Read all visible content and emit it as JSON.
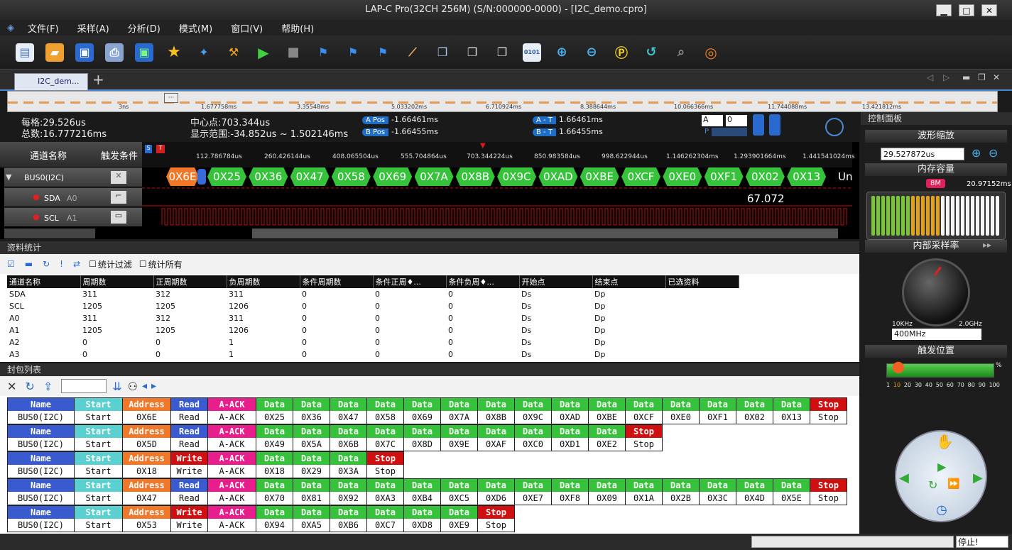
{
  "window": {
    "title": "LAP-C Pro(32CH 256M) (S/N:000000-0000) - [I2C_demo.cpro]"
  },
  "menu": [
    "文件(F)",
    "采样(A)",
    "分析(D)",
    "模式(M)",
    "窗口(V)",
    "帮助(H)"
  ],
  "toolbar": [
    "new-file-icon",
    "open-folder-icon",
    "save-icon",
    "print-icon",
    "save-as-icon",
    "star-icon",
    "run-tools-icon",
    "settings-icon",
    "play-icon",
    "stop-icon",
    "marker-add-icon",
    "marker-a-icon",
    "marker-b-icon",
    "zoom-fit-icon",
    "copy-icon",
    "paste-icon",
    "export-icon",
    "binary-icon",
    "zoom-in-icon",
    "zoom-out-icon",
    "zoom-p-icon",
    "undo-zoom-icon",
    "search-icon",
    "help-ring-icon"
  ],
  "tab": {
    "label": "I2C_dem...",
    "close": "✕",
    "add": "+"
  },
  "overview": {
    "ticks": [
      "3ns",
      "1.677758ms",
      "3.35548ms",
      "5.033202ms",
      "6.710924ms",
      "8.388644ms",
      "10.066366ms",
      "11.744088ms",
      "13.421812ms"
    ]
  },
  "info": {
    "per_div": "每格:29.526us",
    "total": "总数:16.777216ms",
    "center": "中心点:703.344us",
    "range": "显示范围:-34.852us ~ 1.502146ms",
    "a_pos_label": "A Pos",
    "a_pos": "-1.66461ms",
    "b_pos_label": "B Pos",
    "b_pos": "-1.66455ms",
    "a_t_label": "A - T",
    "a_t": "1.66461ms",
    "b_t_label": "B - T",
    "b_t": "1.66455ms",
    "sel1": "A",
    "sel2": "0",
    "p": "P"
  },
  "channels": {
    "header_name": "通道名称",
    "header_trigger": "触发条件",
    "bus": "BUS0(I2C)",
    "sda": "SDA",
    "sda_alias": "A0",
    "scl": "SCL",
    "scl_alias": "A1"
  },
  "ruler": [
    "112.786784us",
    "260.426144us",
    "408.065504us",
    "555.704864us",
    "703.344224us",
    "850.983584us",
    "998.622944us",
    "1.146262304ms",
    "1.293901664ms",
    "1.441541024ms"
  ],
  "wave": {
    "packets": [
      "0X6E",
      "0X25",
      "0X36",
      "0X47",
      "0X58",
      "0X69",
      "0X7A",
      "0X8B",
      "0X9C",
      "0XAD",
      "0XBE",
      "0XCF",
      "0XE0",
      "0XF1",
      "0X02",
      "0X13"
    ],
    "tail": "Un",
    "measure": "67.072"
  },
  "stats": {
    "title": "资料统计",
    "filter": "统计过滤",
    "all": "统计所有",
    "columns": [
      "通道名称",
      "周期数",
      "正周期数",
      "负周期数",
      "条件周期数",
      "条件正周♦...",
      "条件负周♦...",
      "开始点",
      "结束点",
      "已选资料"
    ],
    "rows": [
      [
        "SDA",
        "311",
        "312",
        "311",
        "0",
        "0",
        "0",
        "Ds",
        "Dp",
        ""
      ],
      [
        "SCL",
        "1205",
        "1205",
        "1206",
        "0",
        "0",
        "0",
        "Ds",
        "Dp",
        ""
      ],
      [
        "A0",
        "311",
        "312",
        "311",
        "0",
        "0",
        "0",
        "Ds",
        "Dp",
        ""
      ],
      [
        "A1",
        "1205",
        "1205",
        "1206",
        "0",
        "0",
        "0",
        "Ds",
        "Dp",
        ""
      ],
      [
        "A2",
        "0",
        "0",
        "1",
        "0",
        "0",
        "0",
        "Ds",
        "Dp",
        ""
      ],
      [
        "A3",
        "0",
        "0",
        "1",
        "0",
        "0",
        "0",
        "Ds",
        "Dp",
        ""
      ]
    ]
  },
  "packets": {
    "title": "封包列表",
    "rows": [
      {
        "dir": "Read",
        "data": [
          "0X25",
          "0X36",
          "0X47",
          "0X58",
          "0X69",
          "0X7A",
          "0X8B",
          "0X9C",
          "0XAD",
          "0XBE",
          "0XCF",
          "0XE0",
          "0XF1",
          "0X02",
          "0X13"
        ],
        "addr": "0X6E"
      },
      {
        "dir": "Read",
        "data": [
          "0X49",
          "0X5A",
          "0X6B",
          "0X7C",
          "0X8D",
          "0X9E",
          "0XAF",
          "0XC0",
          "0XD1",
          "0XE2"
        ],
        "addr": "0X5D"
      },
      {
        "dir": "Write",
        "data": [
          "0X18",
          "0X29",
          "0X3A"
        ],
        "addr": "0X18"
      },
      {
        "dir": "Read",
        "data": [
          "0X70",
          "0X81",
          "0X92",
          "0XA3",
          "0XB4",
          "0XC5",
          "0XD6",
          "0XE7",
          "0XF8",
          "0X09",
          "0X1A",
          "0X2B",
          "0X3C",
          "0X4D",
          "0X5E"
        ],
        "addr": "0X47"
      },
      {
        "dir": "Write",
        "data": [
          "0X94",
          "0XA5",
          "0XB6",
          "0XC7",
          "0XD8",
          "0XE9"
        ],
        "addr": "0X53"
      }
    ],
    "labels": {
      "name": "Name",
      "bus": "BUS0(I2C)",
      "start": "Start",
      "address": "Address",
      "ack": "A-ACK",
      "data": "Data",
      "stop": "Stop"
    }
  },
  "right": {
    "title": "控制面板",
    "zoom_title": "波形缩放",
    "zoom_value": "29.527872us",
    "mem_title": "内存容量",
    "mem_marker": "8M",
    "mem_value": "20.97152ms",
    "rate_title": "内部采样率",
    "rate_min": "10KHz",
    "rate_max": "2.0GHz",
    "rate_value": "400MHz",
    "trig_title": "触发位置",
    "trig_pct": "%",
    "trig_ticks": [
      "1",
      "10",
      "20",
      "30",
      "40",
      "50",
      "60",
      "70",
      "80",
      "90",
      "100"
    ]
  },
  "status": {
    "stop": "停止!"
  },
  "colors": {
    "green": "#36c23a",
    "orange": "#f07828",
    "blue": "#3a5bd0",
    "pink": "#e81e8c",
    "red": "#d01010",
    "cyan": "#5ad0d0"
  }
}
